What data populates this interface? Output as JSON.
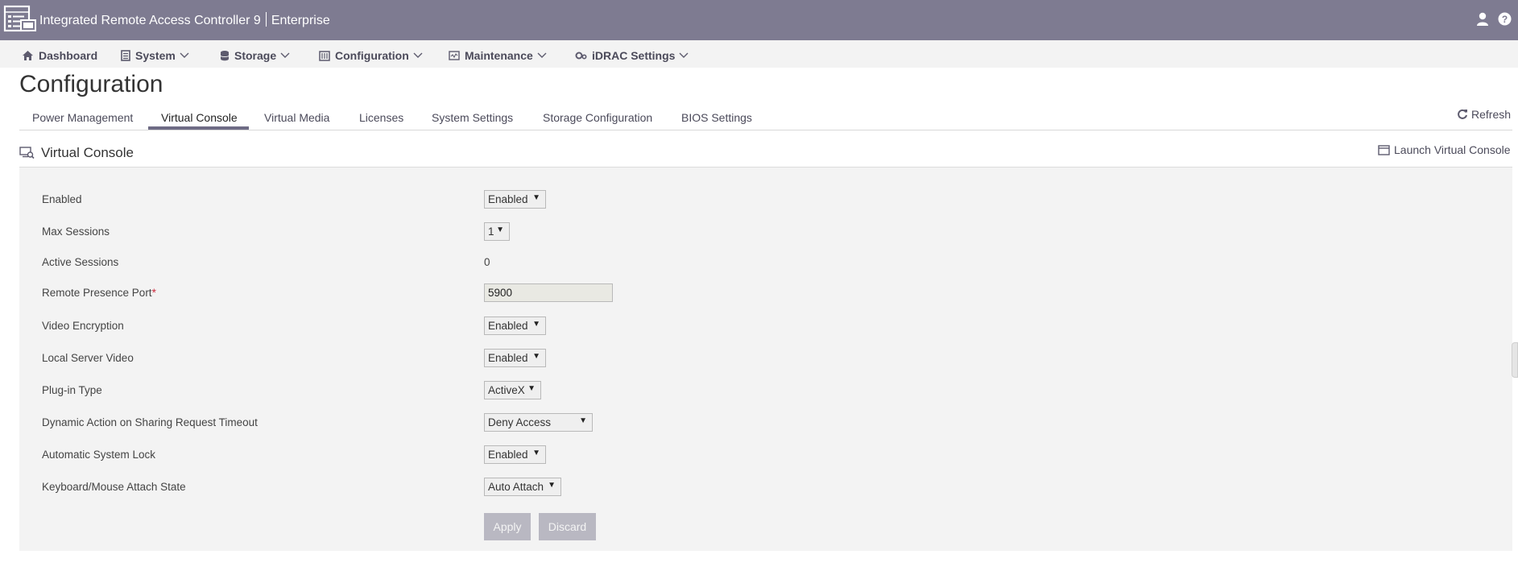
{
  "header": {
    "app_title": "Integrated Remote Access Controller 9",
    "edition": "Enterprise"
  },
  "nav": {
    "items": [
      {
        "label": "Dashboard",
        "icon": "home-icon"
      },
      {
        "label": "System",
        "icon": "server-icon"
      },
      {
        "label": "Storage",
        "icon": "database-icon"
      },
      {
        "label": "Configuration",
        "icon": "configuration-icon"
      },
      {
        "label": "Maintenance",
        "icon": "maintenance-icon"
      },
      {
        "label": "iDRAC Settings",
        "icon": "gears-icon"
      }
    ]
  },
  "page": {
    "title": "Configuration",
    "refresh_label": "Refresh"
  },
  "tabs": [
    {
      "label": "Power Management"
    },
    {
      "label": "Virtual Console",
      "active": true
    },
    {
      "label": "Virtual Media"
    },
    {
      "label": "Licenses"
    },
    {
      "label": "System Settings"
    },
    {
      "label": "Storage Configuration"
    },
    {
      "label": "BIOS Settings"
    }
  ],
  "section": {
    "title": "Virtual Console",
    "launch_label": "Launch Virtual Console"
  },
  "form": {
    "enabled": {
      "label": "Enabled",
      "value": "Enabled"
    },
    "max_sessions": {
      "label": "Max Sessions",
      "value": "1"
    },
    "active_sessions": {
      "label": "Active Sessions",
      "value": "0"
    },
    "remote_port": {
      "label": "Remote Presence Port",
      "required_mark": "*",
      "value": "5900"
    },
    "video_encryption": {
      "label": "Video Encryption",
      "value": "Enabled"
    },
    "local_server_video": {
      "label": "Local Server Video",
      "value": "Enabled"
    },
    "plugin_type": {
      "label": "Plug-in Type",
      "value": "ActiveX"
    },
    "dynamic_action": {
      "label": "Dynamic Action on Sharing Request Timeout",
      "value": "Deny Access"
    },
    "auto_lock": {
      "label": "Automatic System Lock",
      "value": "Enabled"
    },
    "kbd_mouse": {
      "label": "Keyboard/Mouse Attach State",
      "value": "Auto Attach"
    }
  },
  "buttons": {
    "apply": "Apply",
    "discard": "Discard"
  },
  "colors": {
    "header_bg": "#7e7b91",
    "nav_bg": "#f3f3f3",
    "panel_bg": "#f3f3f3",
    "tab_active_underline": "#6e6b85",
    "required_mark": "#cc2a3c",
    "disabled_button": "#b9b8c2"
  }
}
